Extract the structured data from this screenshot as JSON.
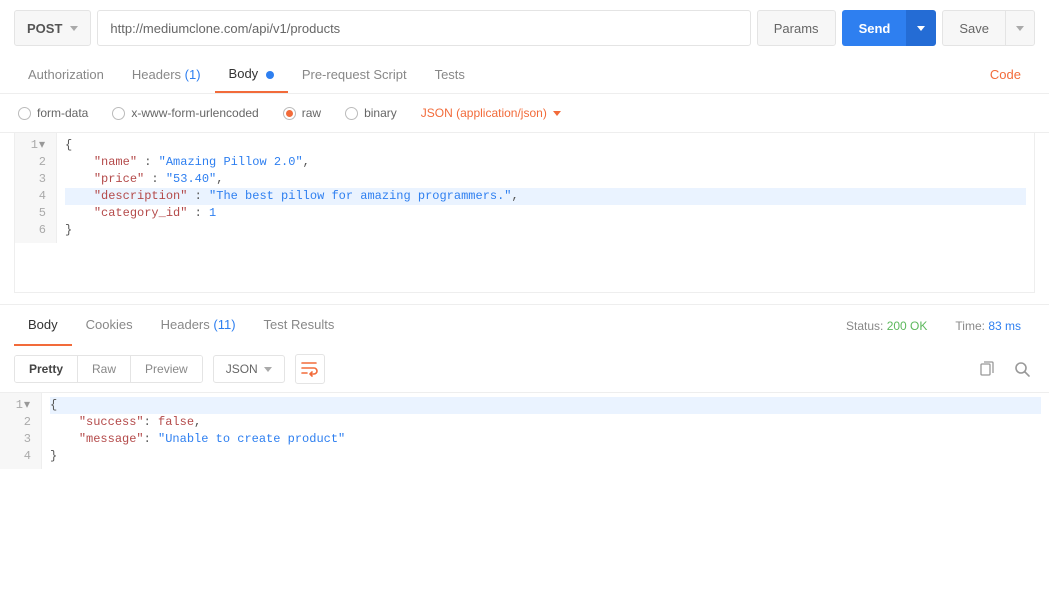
{
  "toolbar": {
    "method": "POST",
    "url": "http://mediumclone.com/api/v1/products",
    "params_label": "Params",
    "send_label": "Send",
    "save_label": "Save"
  },
  "req_tabs": {
    "auth": "Authorization",
    "headers": "Headers",
    "headers_count": "(1)",
    "body": "Body",
    "prereq": "Pre-request Script",
    "tests": "Tests",
    "code": "Code"
  },
  "body_types": {
    "form_data": "form-data",
    "urlencoded": "x-www-form-urlencoded",
    "raw": "raw",
    "binary": "binary",
    "content_type": "JSON (application/json)"
  },
  "req_body": {
    "lines": [
      "1",
      "2",
      "3",
      "4",
      "5",
      "6"
    ],
    "l1": "{",
    "l2_key": "\"name\"",
    "l2_sep": " : ",
    "l2_val": "\"Amazing Pillow 2.0\"",
    "l2_end": ",",
    "l3_key": "\"price\"",
    "l3_sep": " : ",
    "l3_val": "\"53.40\"",
    "l3_end": ",",
    "l4_key": "\"description\"",
    "l4_sep": " : ",
    "l4_val": "\"The best pillow for amazing programmers.\"",
    "l4_end": ",",
    "l5_key": "\"category_id\"",
    "l5_sep": " : ",
    "l5_val": "1",
    "l6": "}"
  },
  "resp_tabs": {
    "body": "Body",
    "cookies": "Cookies",
    "headers": "Headers",
    "headers_count": "(11)",
    "tests": "Test Results"
  },
  "status": {
    "status_label": "Status:",
    "status_value": "200 OK",
    "time_label": "Time:",
    "time_value": "83 ms"
  },
  "resp_toolbar": {
    "pretty": "Pretty",
    "raw": "Raw",
    "preview": "Preview",
    "format": "JSON"
  },
  "resp_body": {
    "lines": [
      "1",
      "2",
      "3",
      "4"
    ],
    "l1": "{",
    "l2_key": "\"success\"",
    "l2_sep": ": ",
    "l2_val": "false",
    "l2_end": ",",
    "l3_key": "\"message\"",
    "l3_sep": ": ",
    "l3_val": "\"Unable to create product\"",
    "l4": "}"
  }
}
